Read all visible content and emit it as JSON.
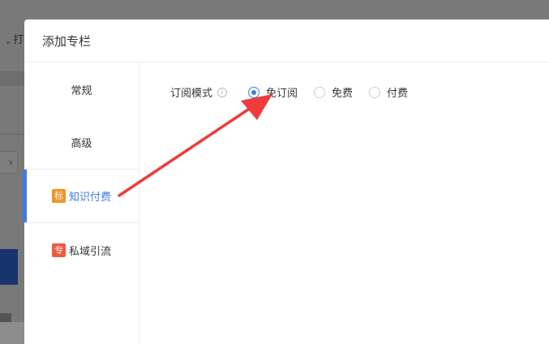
{
  "background_page": {
    "fragment_text": ", 打包"
  },
  "modal": {
    "title": "添加专栏",
    "nav": [
      {
        "label": "常规"
      },
      {
        "label": "高级"
      },
      {
        "label": "知识付费",
        "tag": "标",
        "tag_color": "#f39327",
        "active": true
      },
      {
        "label": "私域引流",
        "tag": "专",
        "tag_color": "#ef5a41"
      }
    ],
    "subscription": {
      "label": "订阅模式",
      "info_icon": "info-icon",
      "options": [
        {
          "label": "免订阅",
          "checked": true
        },
        {
          "label": "免费",
          "checked": false
        },
        {
          "label": "付费",
          "checked": false
        }
      ]
    }
  },
  "annotation": {
    "arrow_color": "#ee3b3b"
  },
  "colors": {
    "accent": "#3d7be4"
  }
}
